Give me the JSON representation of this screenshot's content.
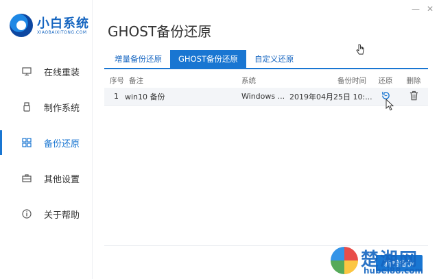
{
  "app": {
    "logo_text": "小白系统",
    "logo_sub": "XIAOBAIXITONG.COM"
  },
  "window": {
    "minimize": "—",
    "close": "✕"
  },
  "sidebar": {
    "items": [
      {
        "label": "在线重装",
        "icon": "monitor-icon"
      },
      {
        "label": "制作系统",
        "icon": "usb-icon"
      },
      {
        "label": "备份还原",
        "icon": "grid-icon",
        "active": true
      },
      {
        "label": "其他设置",
        "icon": "briefcase-icon"
      },
      {
        "label": "关于帮助",
        "icon": "info-icon"
      }
    ]
  },
  "main": {
    "title": "GHOST备份还原",
    "tabs": [
      {
        "label": "增量备份还原"
      },
      {
        "label": "GHOST备份还原",
        "active": true
      },
      {
        "label": "自定义还原"
      }
    ],
    "table": {
      "headers": {
        "no": "序号",
        "note": "备注",
        "system": "系统",
        "time": "备份时间",
        "restore": "还原",
        "delete": "删除"
      },
      "rows": [
        {
          "no": "1",
          "note": "win10 备份",
          "system": "Windows ...",
          "time": "2019年04月25日 10:..."
        }
      ]
    },
    "new_button": "新增备份"
  },
  "watermark": {
    "text": "楚湘网",
    "url": "hubei88.com"
  },
  "colors": {
    "accent": "#1976d2",
    "brand": "#1565c0"
  }
}
